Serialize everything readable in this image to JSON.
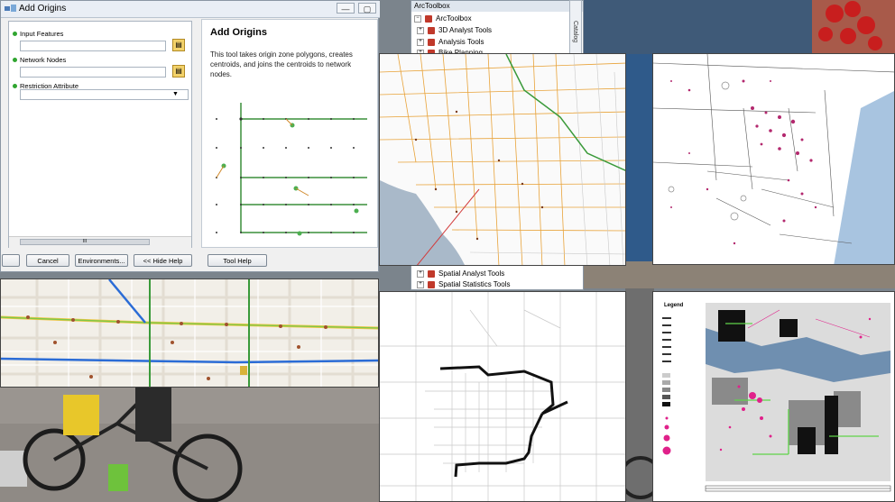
{
  "dialog": {
    "title": "Add Origins",
    "window_buttons": [
      "—",
      "▢",
      "✕"
    ],
    "params": [
      {
        "label": "Input Features",
        "value": ""
      },
      {
        "label": "Network Nodes",
        "value": ""
      },
      {
        "label": "Restriction Attribute",
        "value": ""
      }
    ],
    "scroll_label": "III",
    "help_title": "Add Origins",
    "help_text": "This tool takes origin zone polygons, creates centroids, and joins the centroids to network nodes.",
    "buttons": {
      "cancel": "Cancel",
      "environments": "Environments...",
      "hide_help": "<< Hide Help",
      "tool_help": "Tool Help"
    }
  },
  "toolbox": {
    "header": "ArcToolbox",
    "root": "ArcToolbox",
    "items_top": [
      "3D Analyst Tools",
      "Analysis Tools",
      "Bike Planning"
    ],
    "items_bottom": [
      "Spatial Analyst Tools",
      "Spatial Statistics Tools"
    ],
    "catalog_tab": "Catalog"
  },
  "legend": {
    "title": "Legend"
  },
  "colors": {
    "accent": "#2fa52f",
    "route_blue": "#2b6cd6",
    "magenta": "#e0218a"
  }
}
